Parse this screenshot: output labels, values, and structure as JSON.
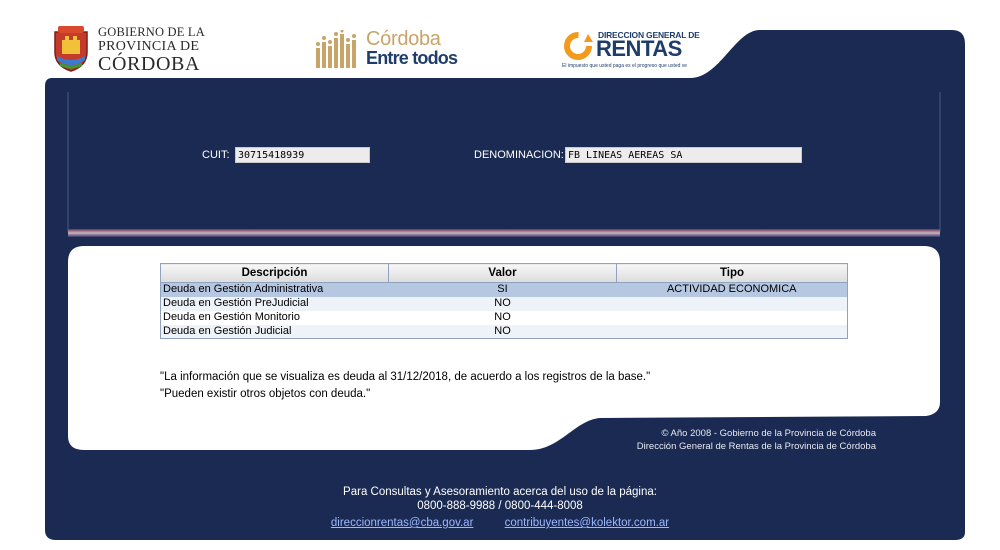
{
  "header": {
    "gobierno": {
      "line1": "GOBIERNO DE LA",
      "line2": "PROVINCIA DE",
      "line3": "CÓRDOBA"
    },
    "cordoba": {
      "line1": "Córdoba",
      "line2": "Entre todos"
    },
    "rentas": {
      "line1": "DIRECCION GENERAL DE",
      "line2": "RENTAS",
      "slogan": "El impuesto que usted paga es el progreso que usted ve"
    }
  },
  "form": {
    "cuit_label": "CUIT:",
    "cuit_value": "30715418939",
    "denominacion_label": "DENOMINACION:",
    "denominacion_value": "FB LINEAS AEREAS SA"
  },
  "table": {
    "headers": [
      "Descripción",
      "Valor",
      "Tipo"
    ],
    "rows": [
      {
        "descripcion": "Deuda en Gestión Administrativa",
        "valor": "SI",
        "tipo": "ACTIVIDAD ECONOMICA"
      },
      {
        "descripcion": "Deuda en Gestión PreJudicial",
        "valor": "NO",
        "tipo": ""
      },
      {
        "descripcion": "Deuda en Gestión Monitorio",
        "valor": "NO",
        "tipo": ""
      },
      {
        "descripcion": "Deuda en Gestión Judicial",
        "valor": "NO",
        "tipo": ""
      }
    ]
  },
  "notes": {
    "line1": "\"La información que se visualiza es deuda al 31/12/2018, de acuerdo a los registros de la base.\"",
    "line2": "\"Pueden existir otros objetos con deuda.\""
  },
  "copyright": {
    "line1": "© Año 2008 - Gobierno de la Provincia de Córdoba",
    "line2": "Dirección General de Rentas de la Provincia de Córdoba"
  },
  "footer": {
    "line1": "Para Consultas y Asesoramiento acerca del uso de la página:",
    "line2": "0800-888-9988 / 0800-444-8008",
    "link1": "direccionrentas@cba.gov.ar",
    "link2": "contribuyentes@kolektor.com.ar"
  },
  "colors": {
    "navy": "#1a2a52",
    "content_bg": "#ffffff",
    "row_selected": "#b6c7e2"
  }
}
